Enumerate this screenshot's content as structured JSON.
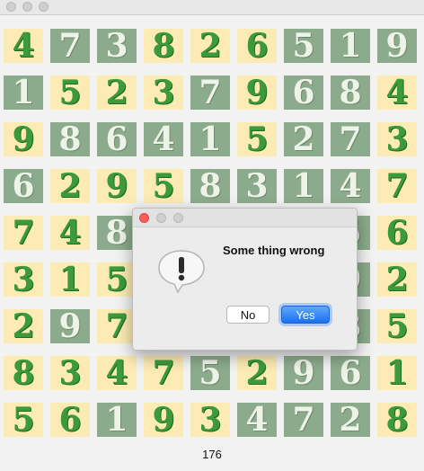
{
  "window": {
    "controls": [
      "close",
      "minimize",
      "zoom"
    ]
  },
  "grid": {
    "rows": [
      [
        {
          "digit": "4",
          "bg": "light"
        },
        {
          "digit": "7",
          "bg": "dark"
        },
        {
          "digit": "3",
          "bg": "dark"
        },
        {
          "digit": "8",
          "bg": "light"
        },
        {
          "digit": "2",
          "bg": "light"
        },
        {
          "digit": "6",
          "bg": "light"
        },
        {
          "digit": "5",
          "bg": "dark"
        },
        {
          "digit": "1",
          "bg": "dark"
        },
        {
          "digit": "9",
          "bg": "dark"
        }
      ],
      [
        {
          "digit": "1",
          "bg": "dark"
        },
        {
          "digit": "5",
          "bg": "light"
        },
        {
          "digit": "2",
          "bg": "light"
        },
        {
          "digit": "3",
          "bg": "light"
        },
        {
          "digit": "7",
          "bg": "dark"
        },
        {
          "digit": "9",
          "bg": "light"
        },
        {
          "digit": "6",
          "bg": "dark"
        },
        {
          "digit": "8",
          "bg": "dark"
        },
        {
          "digit": "4",
          "bg": "light"
        }
      ],
      [
        {
          "digit": "9",
          "bg": "light"
        },
        {
          "digit": "8",
          "bg": "dark"
        },
        {
          "digit": "6",
          "bg": "dark"
        },
        {
          "digit": "4",
          "bg": "dark"
        },
        {
          "digit": "1",
          "bg": "dark"
        },
        {
          "digit": "5",
          "bg": "light"
        },
        {
          "digit": "2",
          "bg": "dark"
        },
        {
          "digit": "7",
          "bg": "dark"
        },
        {
          "digit": "3",
          "bg": "light"
        }
      ],
      [
        {
          "digit": "6",
          "bg": "dark"
        },
        {
          "digit": "2",
          "bg": "light"
        },
        {
          "digit": "9",
          "bg": "light"
        },
        {
          "digit": "5",
          "bg": "light"
        },
        {
          "digit": "8",
          "bg": "dark"
        },
        {
          "digit": "3",
          "bg": "dark"
        },
        {
          "digit": "1",
          "bg": "dark"
        },
        {
          "digit": "4",
          "bg": "dark"
        },
        {
          "digit": "7",
          "bg": "light"
        }
      ],
      [
        {
          "digit": "7",
          "bg": "light"
        },
        {
          "digit": "4",
          "bg": "light"
        },
        {
          "digit": "8",
          "bg": "dark"
        },
        {
          "digit": "",
          "bg": "dark"
        },
        {
          "digit": "",
          "bg": "dark"
        },
        {
          "digit": "",
          "bg": "dark"
        },
        {
          "digit": "",
          "bg": "dark"
        },
        {
          "digit": "5",
          "bg": "dark"
        },
        {
          "digit": "6",
          "bg": "light"
        }
      ],
      [
        {
          "digit": "3",
          "bg": "light"
        },
        {
          "digit": "1",
          "bg": "light"
        },
        {
          "digit": "5",
          "bg": "light"
        },
        {
          "digit": "",
          "bg": "dark"
        },
        {
          "digit": "",
          "bg": "dark"
        },
        {
          "digit": "",
          "bg": "dark"
        },
        {
          "digit": "",
          "bg": "dark"
        },
        {
          "digit": "9",
          "bg": "dark"
        },
        {
          "digit": "2",
          "bg": "light"
        }
      ],
      [
        {
          "digit": "2",
          "bg": "light"
        },
        {
          "digit": "9",
          "bg": "dark"
        },
        {
          "digit": "7",
          "bg": "light"
        },
        {
          "digit": "",
          "bg": "dark"
        },
        {
          "digit": "",
          "bg": "dark"
        },
        {
          "digit": "",
          "bg": "dark"
        },
        {
          "digit": "",
          "bg": "dark"
        },
        {
          "digit": "3",
          "bg": "dark"
        },
        {
          "digit": "5",
          "bg": "light"
        }
      ],
      [
        {
          "digit": "8",
          "bg": "light"
        },
        {
          "digit": "3",
          "bg": "light"
        },
        {
          "digit": "4",
          "bg": "light"
        },
        {
          "digit": "7",
          "bg": "light"
        },
        {
          "digit": "5",
          "bg": "dark"
        },
        {
          "digit": "2",
          "bg": "light"
        },
        {
          "digit": "9",
          "bg": "dark"
        },
        {
          "digit": "6",
          "bg": "dark"
        },
        {
          "digit": "1",
          "bg": "light"
        }
      ],
      [
        {
          "digit": "5",
          "bg": "light"
        },
        {
          "digit": "6",
          "bg": "light"
        },
        {
          "digit": "1",
          "bg": "dark"
        },
        {
          "digit": "9",
          "bg": "light"
        },
        {
          "digit": "3",
          "bg": "light"
        },
        {
          "digit": "4",
          "bg": "dark"
        },
        {
          "digit": "7",
          "bg": "dark"
        },
        {
          "digit": "2",
          "bg": "dark"
        },
        {
          "digit": "8",
          "bg": "light"
        }
      ]
    ]
  },
  "status": {
    "count": "176"
  },
  "dialog": {
    "message": "Some thing wrong",
    "icon": "alert-caution-icon",
    "no_label": "No",
    "yes_label": "Yes"
  },
  "colors": {
    "light_tile": "#fcebb4",
    "dark_tile": "#8cab8c",
    "accent": "#1a6ff0",
    "close_light": "#fd5f57"
  }
}
